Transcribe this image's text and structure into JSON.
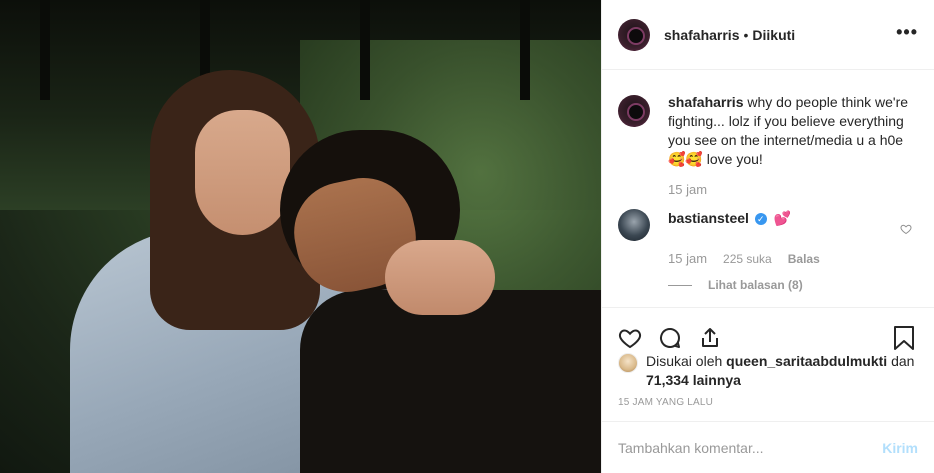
{
  "post": {
    "username": "shafaharris",
    "separator": "•",
    "follow_status": "Diikuti",
    "more_icon": "more-options-icon"
  },
  "caption": {
    "username": "shafaharris",
    "text": "why do people think we're fighting... lolz if you believe everything you see on the internet/media u a h0e",
    "emoji": "🥰🥰",
    "text_end": "love you!",
    "time": "15 jam"
  },
  "comment": {
    "username": "bastiansteel",
    "emoji": "💕",
    "time": "15 jam",
    "likes": "225 suka",
    "reply": "Balas",
    "view_replies": "Lihat balasan (8)"
  },
  "likes": {
    "prefix": "Disukai oleh",
    "user": "queen_saritaabdulmukti",
    "conjunction": "dan",
    "others": "71,334 lainnya"
  },
  "timestamp": "15 JAM YANG LALU",
  "add_comment": {
    "placeholder": "Tambahkan komentar...",
    "send_label": "Kirim"
  },
  "colors": {
    "link_blue": "#3897f0",
    "send_disabled": "#b2dffc",
    "muted": "#999999"
  }
}
